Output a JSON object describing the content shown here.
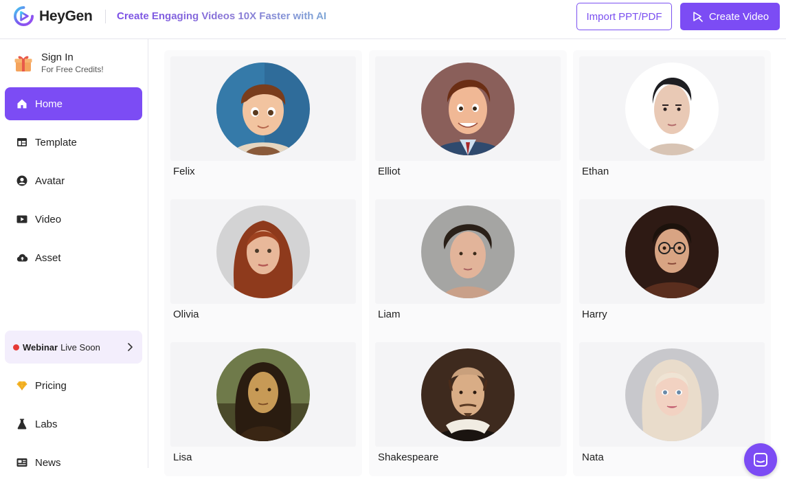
{
  "header": {
    "brand": "HeyGen",
    "tagline": "Create Engaging Videos 10X Faster with AI",
    "import_label": "Import PPT/PDF",
    "create_label": "Create Video"
  },
  "sidebar": {
    "signin_title": "Sign In",
    "signin_sub": "For Free Credits!",
    "items": [
      {
        "label": "Home",
        "icon": "home-icon",
        "active": true
      },
      {
        "label": "Template",
        "icon": "template-icon",
        "active": false
      },
      {
        "label": "Avatar",
        "icon": "avatar-icon",
        "active": false
      },
      {
        "label": "Video",
        "icon": "video-icon",
        "active": false
      },
      {
        "label": "Asset",
        "icon": "asset-cloud-icon",
        "active": false
      }
    ],
    "webinar": {
      "bold": "Webinar",
      "text": "Live Soon"
    },
    "bottom_items": [
      {
        "label": "Pricing",
        "icon": "diamond-icon"
      },
      {
        "label": "Labs",
        "icon": "flask-icon"
      },
      {
        "label": "News",
        "icon": "news-icon"
      }
    ]
  },
  "avatars": [
    {
      "name": "Felix"
    },
    {
      "name": "Elliot"
    },
    {
      "name": "Ethan"
    },
    {
      "name": "Olivia"
    },
    {
      "name": "Liam"
    },
    {
      "name": "Harry"
    },
    {
      "name": "Lisa"
    },
    {
      "name": "Shakespeare"
    },
    {
      "name": "Nata"
    }
  ],
  "colors": {
    "accent": "#7c4cf4",
    "webinar_bg": "#f3eefc",
    "live_dot": "#e53935"
  }
}
